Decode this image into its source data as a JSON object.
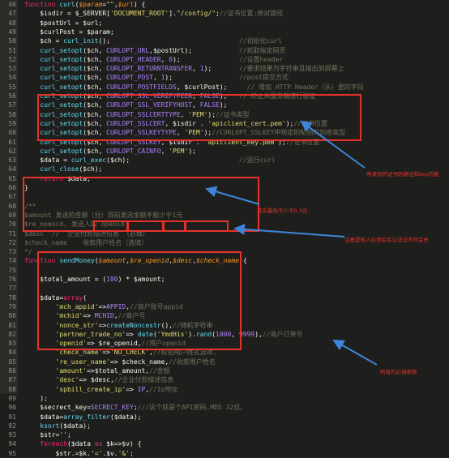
{
  "lines": [
    {
      "n": "46",
      "t": "function curl($param=\"\",$url) {"
    },
    {
      "n": "47",
      "t": "    $isdir = $_SERVER['DOCUMENT_ROOT'].\"/config/\";//证书位置;绝对路径"
    },
    {
      "n": "48",
      "t": "    $postUrl = $url;"
    },
    {
      "n": "49",
      "t": "    $curlPost = $param;"
    },
    {
      "n": "50",
      "t": "    $ch = curl_init();                                 //初始化curl"
    },
    {
      "n": "51",
      "t": "    curl_setopt($ch, CURLOPT_URL,$postUrl);            //抓取指定网页"
    },
    {
      "n": "52",
      "t": "    curl_setopt($ch, CURLOPT_HEADER, 0);               //设置header"
    },
    {
      "n": "53",
      "t": "    curl_setopt($ch, CURLOPT_RETURNTRANSFER, 1);       //要求结果为字符串且输出到屏幕上"
    },
    {
      "n": "54",
      "t": "    curl_setopt($ch, CURLOPT_POST, 1);                 //post提交方式"
    },
    {
      "n": "55",
      "t": "    curl_setopt($ch, CURLOPT_POSTFIELDS, $curlPost);     // 增加 HTTP Header（头）里的字段"
    },
    {
      "n": "56",
      "t": "    curl_setopt($ch, CURLOPT_SSL_VERIFYPEER, FALSE);   // 终止从服务端进行验证"
    },
    {
      "n": "57",
      "t": "    curl_setopt($ch, CURLOPT_SSL_VERIFYHOST, FALSE);"
    },
    {
      "n": "58",
      "t": "    curl_setopt($ch, CURLOPT_SSLCERTTYPE, 'PEM');//证书类型"
    },
    {
      "n": "59",
      "t": "    curl_setopt($ch, CURLOPT_SSLCERT, $isdir . 'apiclient_cert.pem');//证书位置"
    },
    {
      "n": "60",
      "t": "    curl_setopt($ch, CURLOPT_SSLKEYTYPE, 'PEM');//CURLOPT_SSLKEY中规定的私钥的加密类型"
    },
    {
      "n": "61",
      "t": "    curl_setopt($ch, CURLOPT_SSLKEY, $isdir . 'apiclient_key.pem');//证书位置"
    },
    {
      "n": "62",
      "t": "    curl_setopt($ch, CURLOPT_CAINFO, 'PEM');"
    },
    {
      "n": "63",
      "t": "    $data = curl_exec($ch);                            //运行curl"
    },
    {
      "n": "64",
      "t": "    curl_close($ch);"
    },
    {
      "n": "65",
      "t": "    return $data;"
    },
    {
      "n": "66",
      "t": "}"
    },
    {
      "n": "67",
      "t": ""
    },
    {
      "n": "68",
      "t": "/**"
    },
    {
      "n": "69",
      "t": "$amount 发送的金额（分）目前发送金额不能少于1元"
    },
    {
      "n": "70",
      "t": "$re_openid, 发送人的 openid"
    },
    {
      "n": "71",
      "t": "$desc  //  企业付款描述信息 （必填）"
    },
    {
      "n": "72",
      "t": "$check_name    收款用户姓名（选填）"
    },
    {
      "n": "73",
      "t": "*/"
    },
    {
      "n": "74",
      "t": "function sendMoney($amount,$re_openid,$desc,$check_name){"
    },
    {
      "n": "75",
      "t": ""
    },
    {
      "n": "76",
      "t": "    $total_amount = (100) * $amount;"
    },
    {
      "n": "77",
      "t": ""
    },
    {
      "n": "78",
      "t": "    $data=array("
    },
    {
      "n": "79",
      "t": "        'mch_appid'=>APPID,//商户账号appid"
    },
    {
      "n": "80",
      "t": "        'mchid'=> MCHID,//商户号"
    },
    {
      "n": "81",
      "t": "        'nonce_str'=>createNoncestr(),//随机字符串"
    },
    {
      "n": "82",
      "t": "        'partner_trade_no'=> date('YmdHis').rand(1000, 9999),//商户订单号"
    },
    {
      "n": "83",
      "t": "        'openid'=> $re_openid,//用户openid"
    },
    {
      "n": "84",
      "t": "        'check_name'=>'NO_CHECK',//校验用户姓名选项,"
    },
    {
      "n": "85",
      "t": "        're_user_name'=> $check_name,//收款用户姓名"
    },
    {
      "n": "86",
      "t": "        'amount'=>$total_amount,//金额"
    },
    {
      "n": "87",
      "t": "        'desc'=> $desc,//企业付款描述信息"
    },
    {
      "n": "88",
      "t": "        'spbill_create_ip'=> IP,//Ip地址"
    },
    {
      "n": "89",
      "t": "    );"
    },
    {
      "n": "90",
      "t": "    $secrect_key=SECRECT_KEY;///这个就是个API密码,MD5 32位。"
    },
    {
      "n": "91",
      "t": "    $data=array_filter($data);"
    },
    {
      "n": "92",
      "t": "    ksort($data);"
    },
    {
      "n": "93",
      "t": "    $str='';"
    },
    {
      "n": "94",
      "t": "    foreach($data as $k=>$v) {"
    },
    {
      "n": "95",
      "t": "        $str.=$k.'='.$v.'&';"
    }
  ],
  "notes": {
    "cert_note": "申请到的证书的路径和key的路",
    "amount_note": "其实最低不少于0.3元",
    "check_name_note": "注意提现人必须实名认证过不然会失",
    "params_note": "所有的必填参数"
  },
  "colors": {
    "accent": "#e8312a",
    "background": "#1e1f1c"
  }
}
